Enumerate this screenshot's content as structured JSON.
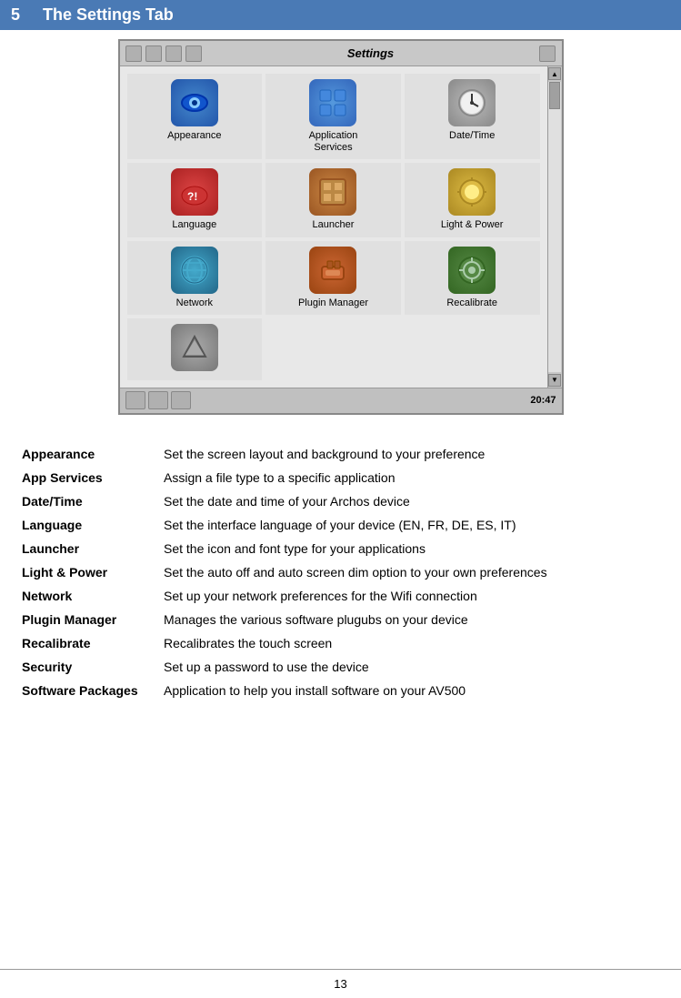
{
  "header": {
    "chapter": "5",
    "title": "The Settings Tab"
  },
  "screenshot": {
    "titlebar": {
      "title": "Settings"
    },
    "items": [
      {
        "id": "appearance",
        "label": "Appearance",
        "icon": "👁",
        "iconClass": "icon-appearance"
      },
      {
        "id": "appservices",
        "label": "Application\nServices",
        "icon": "⊞",
        "iconClass": "icon-appservices"
      },
      {
        "id": "datetime",
        "label": "Date/Time",
        "icon": "⏱",
        "iconClass": "icon-datetime"
      },
      {
        "id": "language",
        "label": "Language",
        "icon": "💬",
        "iconClass": "icon-language"
      },
      {
        "id": "launcher",
        "label": "Launcher",
        "icon": "⊠",
        "iconClass": "icon-launcher"
      },
      {
        "id": "lightpower",
        "label": "Light & Power",
        "icon": "🔍",
        "iconClass": "icon-lightpower"
      },
      {
        "id": "network",
        "label": "Network",
        "icon": "🌐",
        "iconClass": "icon-network"
      },
      {
        "id": "pluginmgr",
        "label": "Plugin Manager",
        "icon": "🔧",
        "iconClass": "icon-pluginmgr"
      },
      {
        "id": "recalibrate",
        "label": "Recalibrate",
        "icon": "🎯",
        "iconClass": "icon-recalibrate"
      },
      {
        "id": "extra",
        "label": "",
        "icon": "🏔",
        "iconClass": "icon-extra"
      }
    ],
    "bottombar": {
      "time": "20:47"
    }
  },
  "definitions": [
    {
      "term": "Appearance",
      "def": "Set the screen layout and background to your preference"
    },
    {
      "term": "App Services",
      "def": "Assign a file type to a specific application"
    },
    {
      "term": "Date/Time",
      "def": "Set the date and time of your Archos device"
    },
    {
      "term": "Language",
      "def": "Set the interface language of your device (EN, FR, DE, ES, IT)"
    },
    {
      "term": "Launcher",
      "def": "Set the icon and font type for your applications"
    },
    {
      "term": "Light & Power",
      "def": "Set the auto off and auto screen dim option to your own preferences"
    },
    {
      "term": "Network",
      "def": "Set up your network preferences for the Wifi connection"
    },
    {
      "term": "Plugin Manager",
      "def": "Manages the various software plugubs on your device"
    },
    {
      "term": "Recalibrate",
      "def": "Recalibrates the touch screen"
    },
    {
      "term": "Security",
      "def": "Set up a password to use the device"
    },
    {
      "term": "Software Packages",
      "def": "Application to help you install software on your AV500"
    }
  ],
  "footer": {
    "page_number": "13"
  }
}
